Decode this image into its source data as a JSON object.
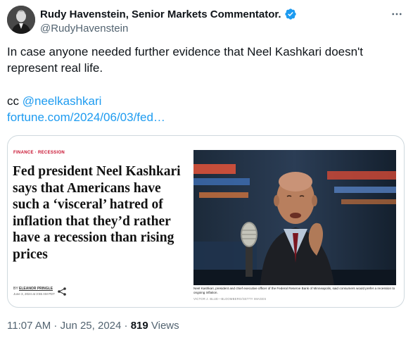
{
  "author": {
    "display_name": "Rudy Havenstein, Senior Markets Commentator.",
    "handle": "@RudyHavenstein",
    "verified": true,
    "verified_icon": "verified-badge-icon",
    "avatar_icon": "profile-avatar"
  },
  "more_icon": "more-options-icon",
  "tweet": {
    "text": "In case anyone needed further evidence that Neel Kashkari doesn't represent real life.",
    "cc_prefix": "cc ",
    "mention": "@neelkashkari",
    "url": "fortune.com/2024/06/03/fed…"
  },
  "card": {
    "tag": "FINANCE · RECESSION",
    "headline": "Fed president Neel Kashkari says that Americans have such a ‘visceral’ hatred of inflation that they’d rather have a recession than rising prices",
    "byline_prefix": "BY",
    "byline_author": "ELEANOR PRINGLE",
    "dateline": "June 3, 2024 at 3:55 AM PDT",
    "share_icon": "share-icon",
    "caption": "Neel Kashkari, president and chief executive officer of the Federal Reserve Bank of Minneapolis, said consumers would prefer a recession to ongoing inflation.",
    "credit": "VICTOR J. BLUE—BLOOMBERG/GETTY IMAGES"
  },
  "meta": {
    "time": "11:07 AM",
    "separator1": " · ",
    "date": "Jun 25, 2024",
    "separator2": " · ",
    "views": "819",
    "views_label": " Views"
  },
  "colors": {
    "link": "#1d9bf0",
    "secondary_text": "#536471",
    "verified": "#1d9bf0",
    "border": "#cfd9de",
    "tag_red": "#c8102e"
  }
}
